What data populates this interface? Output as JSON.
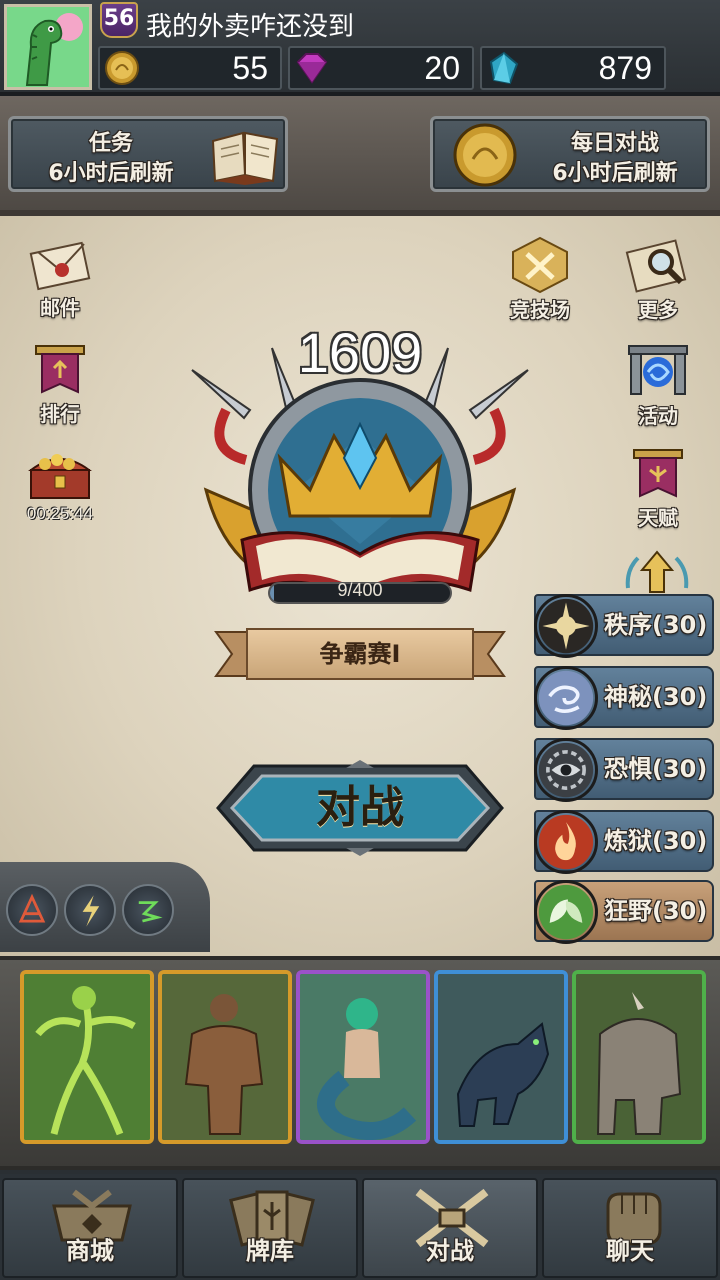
{
  "player": {
    "level": "56",
    "name": "我的外卖咋还没到"
  },
  "resources": {
    "gold": "55",
    "gems": "20",
    "shards": "879"
  },
  "quests": {
    "task_title": "任务",
    "task_sub": "6小时后刷新",
    "daily_title": "每日对战",
    "daily_sub": "6小时后刷新"
  },
  "side_menu": {
    "mail": "邮件",
    "ranking": "排行",
    "chest_timer": "00:25:44",
    "arena": "竞技场",
    "more": "更多",
    "events": "活动",
    "talent": "天赋"
  },
  "ladder": {
    "rating": "1609",
    "progress_text": "9/400",
    "progress_fraction": 0.0225,
    "league": "争霸赛I"
  },
  "battle_label": "对战",
  "factions": [
    {
      "label": "秩序(30)",
      "icon": "sun-icon",
      "color": "#e9d7a0"
    },
    {
      "label": "神秘(30)",
      "icon": "swirl-icon",
      "color": "#9fb3d8"
    },
    {
      "label": "恐惧(30)",
      "icon": "eye-icon",
      "color": "#5c6168"
    },
    {
      "label": "炼狱(30)",
      "icon": "flame-icon",
      "color": "#d04a2b"
    },
    {
      "label": "狂野(30)",
      "icon": "leaf-icon",
      "color": "#5aa84a"
    }
  ],
  "cards": [
    {
      "name": "dryad",
      "rarity_color": "#d69a2a",
      "bg": "#5d8f3c"
    },
    {
      "name": "giant",
      "rarity_color": "#d69a2a",
      "bg": "#5e6d3c"
    },
    {
      "name": "naga",
      "rarity_color": "#9a52c9",
      "bg": "#4b7a6b"
    },
    {
      "name": "wolf",
      "rarity_color": "#3f8fd6",
      "bg": "#455f62"
    },
    {
      "name": "rhino",
      "rarity_color": "#4fb04a",
      "bg": "#4f6a3c"
    }
  ],
  "nav": {
    "shop": "商城",
    "deck": "牌库",
    "battle": "对战",
    "chat": "聊天"
  }
}
